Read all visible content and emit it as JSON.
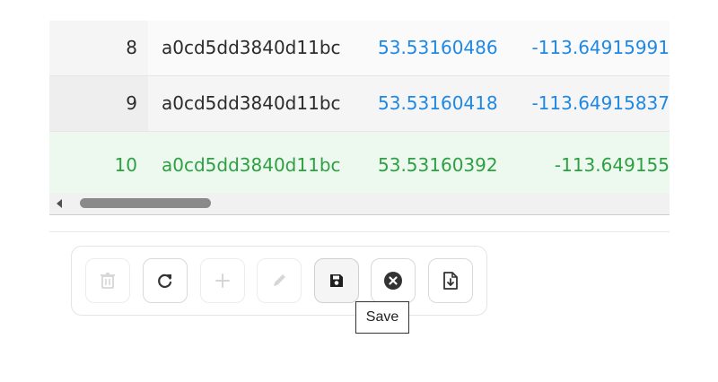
{
  "table": {
    "rows": [
      {
        "index": "8",
        "id": "a0cd5dd3840d11bc",
        "lat": "53.53160486",
        "lon": "-113.64915991"
      },
      {
        "index": "9",
        "id": "a0cd5dd3840d11bc",
        "lat": "53.53160418",
        "lon": "-113.64915837"
      },
      {
        "index": "10",
        "id": "a0cd5dd3840d11bc",
        "lat": "53.53160392",
        "lon": "-113.649155"
      }
    ]
  },
  "toolbar": {
    "buttons": [
      {
        "name": "delete",
        "icon": "trash-icon",
        "enabled": false
      },
      {
        "name": "refresh",
        "icon": "refresh-icon",
        "enabled": true
      },
      {
        "name": "add",
        "icon": "plus-icon",
        "enabled": false
      },
      {
        "name": "edit",
        "icon": "pencil-icon",
        "enabled": false
      },
      {
        "name": "save",
        "icon": "save-icon",
        "enabled": true
      },
      {
        "name": "cancel",
        "icon": "close-circle-icon",
        "enabled": true
      },
      {
        "name": "export",
        "icon": "download-file-icon",
        "enabled": true
      }
    ],
    "tooltip": "Save"
  },
  "colors": {
    "blue": "#1e88e5",
    "green": "#2ea043",
    "selected_row_bg": "#edf9ef"
  }
}
